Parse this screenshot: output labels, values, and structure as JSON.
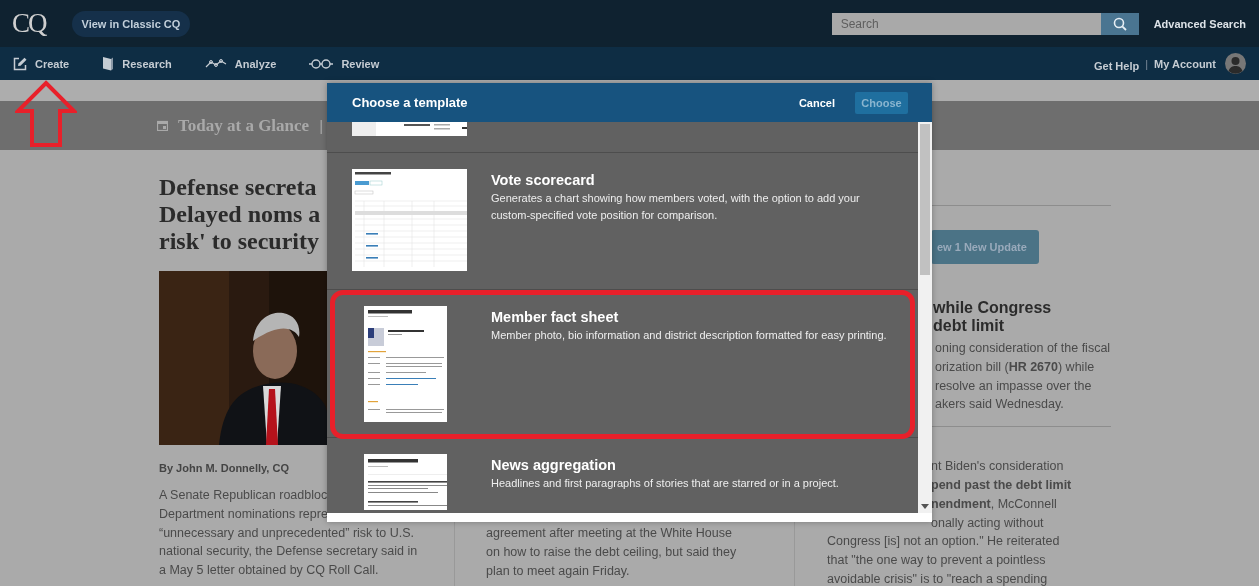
{
  "top_bar": {
    "logo": "CQ",
    "classic_link": "View in Classic CQ",
    "search": {
      "placeholder": "Search"
    },
    "advanced_search": "Advanced Search"
  },
  "nav": {
    "items": [
      {
        "label": "Create",
        "kind": "edit"
      },
      {
        "label": "Research",
        "kind": "book"
      },
      {
        "label": "Analyze",
        "kind": "trend"
      },
      {
        "label": "Review",
        "kind": "glasses"
      }
    ],
    "help": "Get Help",
    "separator": "|",
    "account": "My Account"
  },
  "glance": {
    "title": "Today at a Glance",
    "separator": "|"
  },
  "left_story": {
    "headline": [
      "Defense secreta",
      "Delayed noms a",
      "risk' to security"
    ],
    "byline": "By John M. Donnelly, CQ",
    "lines": [
      "A Senate Republican roadbloc",
      "Department nominations repre",
      "“unnecessary and unprecedented” risk to U.S.",
      "national security, the Defense secretary said in",
      "a May 5 letter obtained by CQ Roll Call."
    ]
  },
  "middle_story": {
    "lines": [
      "agreement after meeting at the White House",
      "on how to raise the debt ceiling, but said they",
      "plan to meet again Friday."
    ]
  },
  "right_story": {
    "update_button": "ew 1 New Update",
    "headline": [
      "while Congress",
      "debt limit"
    ],
    "summary_lines": [
      "oning consideration of the fiscal",
      "orization bill (**HR 2670**) while",
      "resolve an impasse over the",
      "akers said Wednesday."
    ],
    "body_partial_lines": [
      "nt Biden's consideration",
      "**pend past the debt limit**",
      "**nendment**, McConnell",
      "onally acting without"
    ],
    "body_lines": [
      "Congress [is] not an option.\" He reiterated",
      "that \"the one way to prevent a pointless",
      "avoidable crisis\" is to \"reach a spending"
    ]
  },
  "modal": {
    "title": "Choose a template",
    "cancel": "Cancel",
    "choose": {
      "label": "Choose",
      "disabled": true
    },
    "templates": [
      {
        "name": "Vote scorecard",
        "description": "Generates a chart showing how members voted, with the option to add your custom-specified vote position for comparison.",
        "kind": "scorecard"
      },
      {
        "name": "Member fact sheet",
        "description": "Member photo, bio information and district description formatted for easy printing.",
        "kind": "sheet"
      },
      {
        "name": "News aggregation",
        "description": "Headlines and first paragraphs of stories that are starred or in a project.",
        "kind": "news"
      }
    ]
  }
}
